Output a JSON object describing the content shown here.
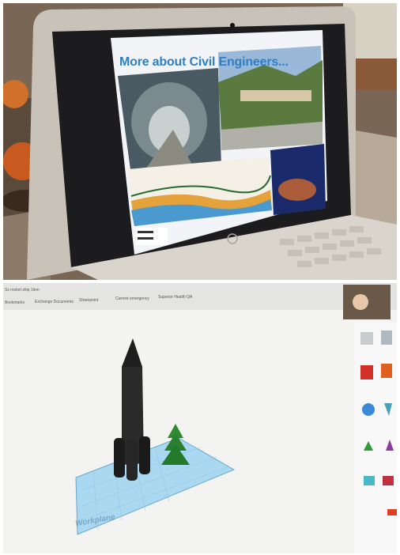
{
  "top_photo": {
    "slide": {
      "title": "More about Civil Engineers..."
    }
  },
  "bottom_photo": {
    "browser": {
      "tab_title": "Ss rocket ship 1lem",
      "bookmarks": [
        "Bookmarks",
        "Exchange Documents",
        "Sharepoint",
        "Current emergency",
        "Superior Health QA"
      ]
    },
    "workplane_label": "Workplane"
  },
  "colors": {
    "slide_title": "#2f7fc4",
    "workplane": "#a9d8f0",
    "rocket": "#222222",
    "tree": "#2e8b2e"
  }
}
